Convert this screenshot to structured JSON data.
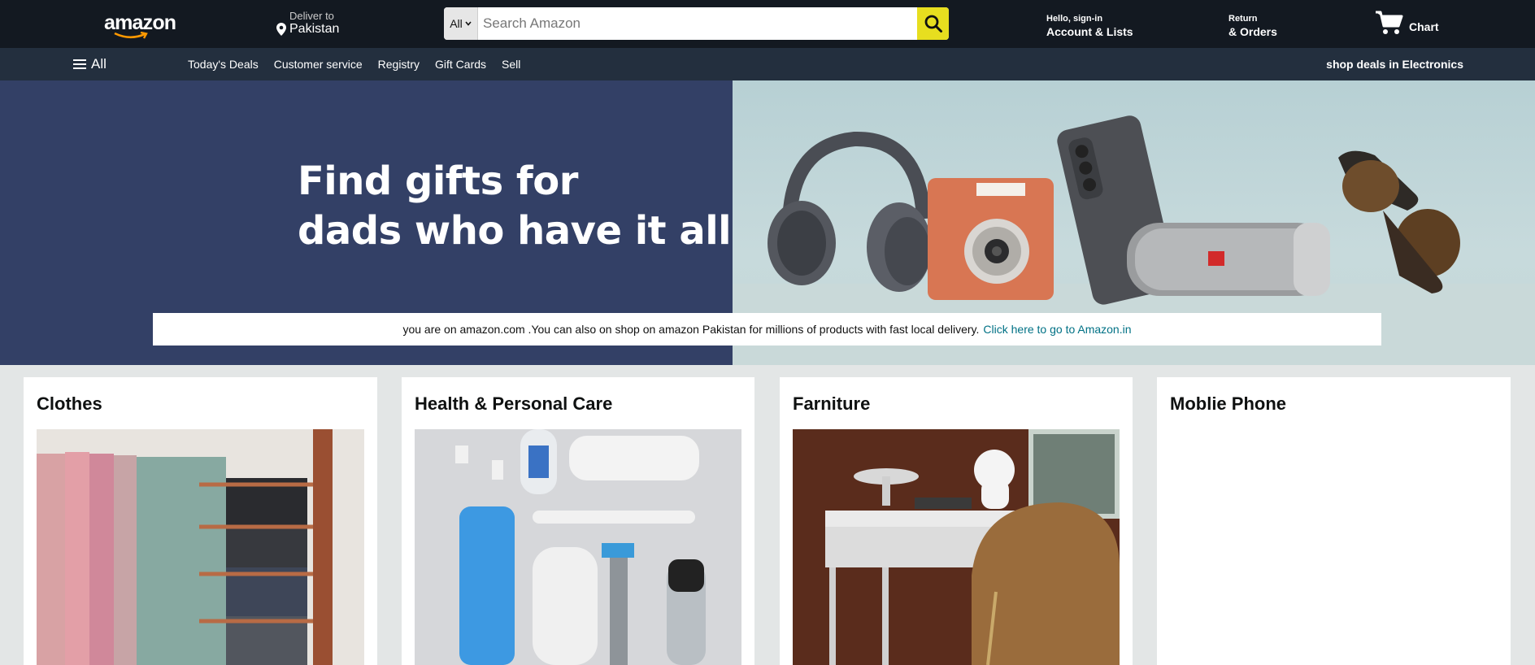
{
  "header": {
    "logo_text": "amazon",
    "deliver_label": "Deliver to",
    "deliver_location": "Pakistan",
    "search": {
      "category": "All",
      "placeholder": "Search Amazon"
    },
    "account": {
      "greeting": "Hello, sign-in",
      "label": "Account & Lists"
    },
    "orders": {
      "line1": "Return",
      "line2": "& Orders"
    },
    "cart_label": "Chart"
  },
  "subnav": {
    "all_label": "All",
    "links": [
      "Today's Deals",
      "Customer service",
      "Registry",
      "Gift Cards",
      "Sell"
    ],
    "promo": "shop deals in Electronics"
  },
  "hero": {
    "heading_line1": "Find gifts for",
    "heading_line2": "dads who have it all",
    "notice_text": "you are on amazon.com .You can also on shop on amazon Pakistan for millions of products with fast local delivery.",
    "notice_link": "Click here to go to Amazon.in"
  },
  "cards": [
    {
      "title": "Clothes"
    },
    {
      "title": "Health & Personal Care"
    },
    {
      "title": "Farniture"
    },
    {
      "title": "Moblie Phone"
    }
  ],
  "colors": {
    "nav_bg": "#131921",
    "subnav_bg": "#232f3e",
    "hero_left_bg": "#334066",
    "search_button": "#e7de1f",
    "link": "#007185"
  }
}
